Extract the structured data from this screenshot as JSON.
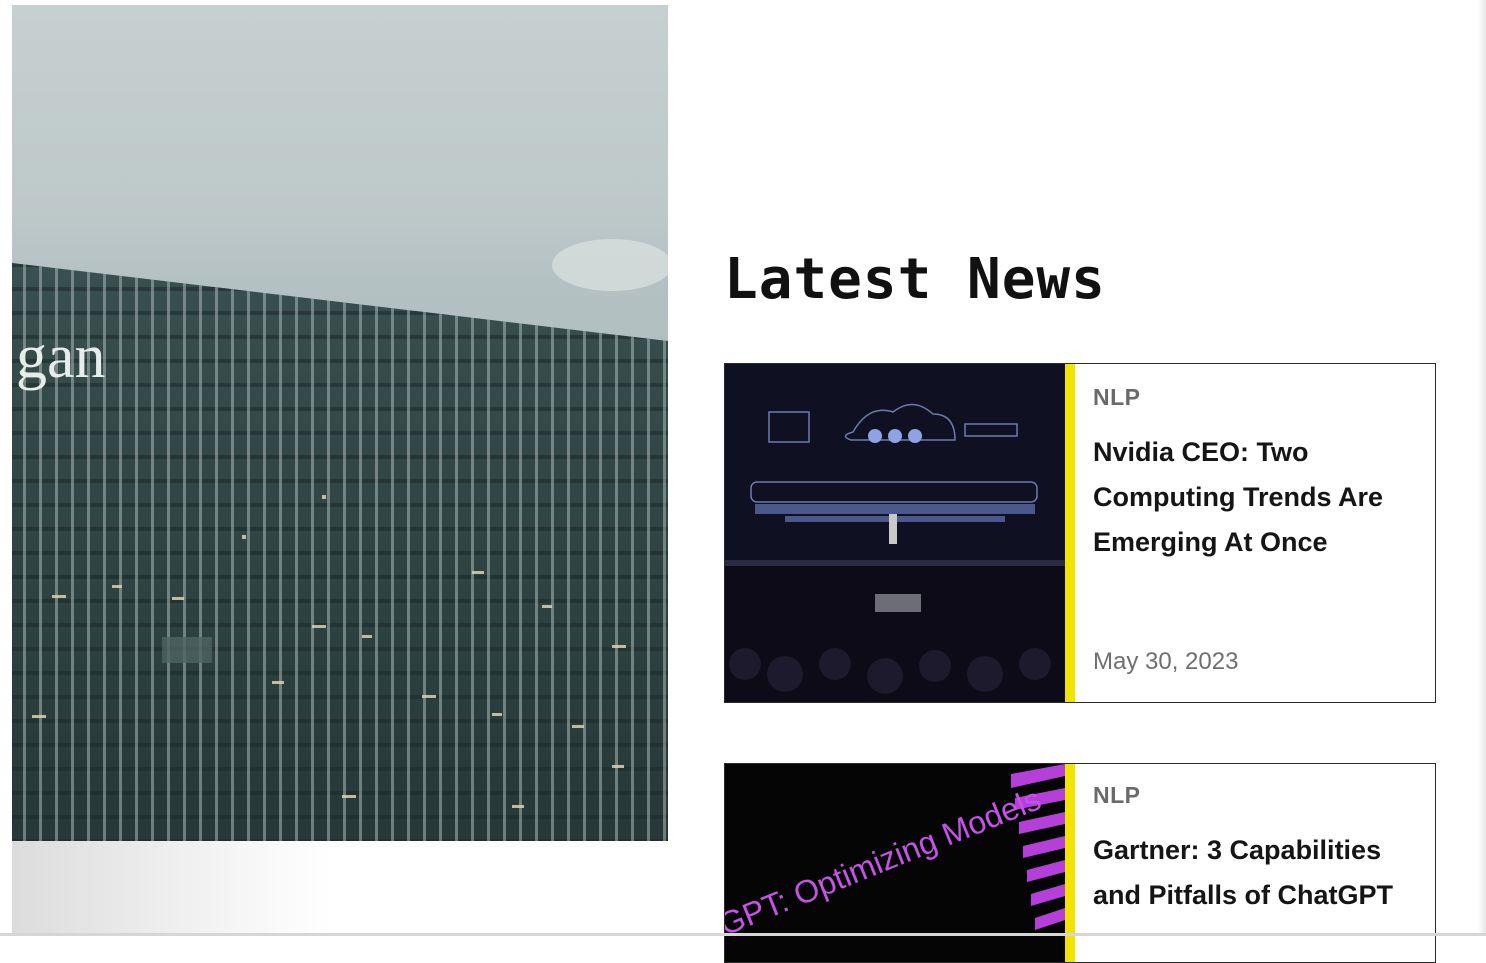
{
  "hero": {
    "building_sign_text": "gan"
  },
  "latest_news": {
    "title": "Latest News",
    "accent_color": "#f2e300",
    "articles": [
      {
        "category": "NLP",
        "headline": "Nvidia CEO: Two Computing Trends Are Emerging At Once",
        "date": "May 30, 2023"
      },
      {
        "category": "NLP",
        "headline": "Gartner: 3 Capabilities and Pitfalls of ChatGPT",
        "date": "",
        "thumb_text": "GPT: Optimizing Models"
      }
    ]
  }
}
